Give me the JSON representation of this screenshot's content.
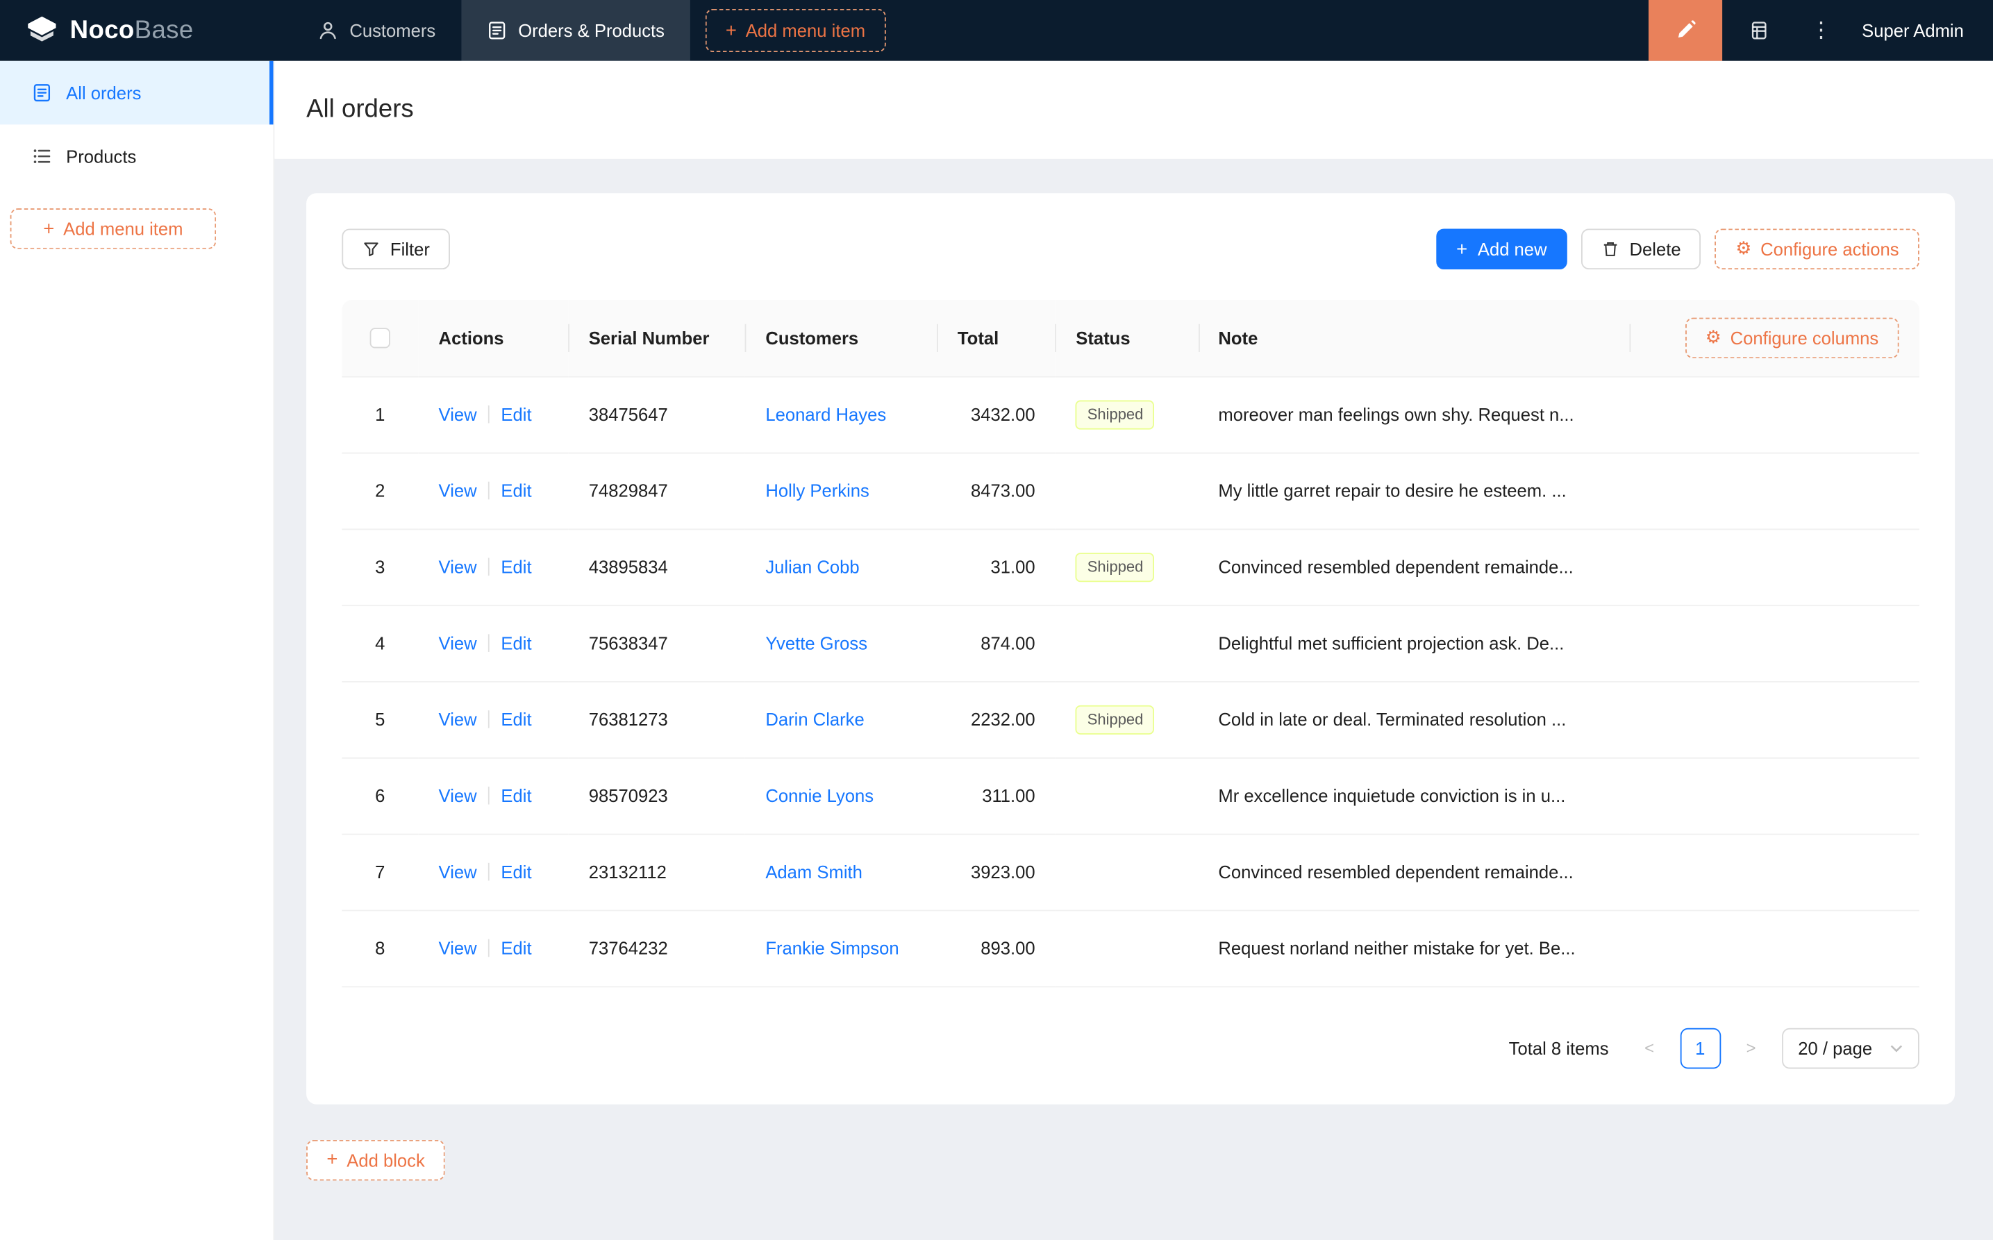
{
  "topbar": {
    "logo_noco": "Noco",
    "logo_base": "Base",
    "tabs": [
      {
        "label": "Customers"
      },
      {
        "label": "Orders & Products"
      }
    ],
    "add_menu_item": "Add menu item",
    "user": "Super Admin"
  },
  "icons": {
    "plus": "+",
    "gear": "⚙",
    "ellipsis": "⋮",
    "prev": "<",
    "next": ">"
  },
  "sidebar": {
    "items": [
      {
        "label": "All orders"
      },
      {
        "label": "Products"
      }
    ],
    "add_menu_item": "Add menu item"
  },
  "page": {
    "title": "All orders"
  },
  "toolbar": {
    "filter": "Filter",
    "add_new": "Add new",
    "delete": "Delete",
    "configure_actions": "Configure actions"
  },
  "table": {
    "columns": {
      "actions": "Actions",
      "serial": "Serial Number",
      "customers": "Customers",
      "total": "Total",
      "status": "Status",
      "note": "Note"
    },
    "configure_columns": "Configure columns",
    "actions": {
      "view": "View",
      "edit": "Edit"
    },
    "rows": [
      {
        "index": 1,
        "serial": "38475647",
        "customer": "Leonard Hayes",
        "total": "3432.00",
        "status": "Shipped",
        "note": "moreover man feelings own shy. Request n..."
      },
      {
        "index": 2,
        "serial": "74829847",
        "customer": "Holly Perkins",
        "total": "8473.00",
        "status": "",
        "note": "My little garret repair to desire he esteem. ..."
      },
      {
        "index": 3,
        "serial": "43895834",
        "customer": "Julian Cobb",
        "total": "31.00",
        "status": "Shipped",
        "note": "Convinced resembled dependent remainde..."
      },
      {
        "index": 4,
        "serial": "75638347",
        "customer": "Yvette Gross",
        "total": "874.00",
        "status": "",
        "note": "Delightful met sufficient projection ask. De..."
      },
      {
        "index": 5,
        "serial": "76381273",
        "customer": "Darin Clarke",
        "total": "2232.00",
        "status": "Shipped",
        "note": "Cold in late or deal. Terminated resolution ..."
      },
      {
        "index": 6,
        "serial": "98570923",
        "customer": "Connie Lyons",
        "total": "311.00",
        "status": "",
        "note": "Mr excellence inquietude conviction is in u..."
      },
      {
        "index": 7,
        "serial": "23132112",
        "customer": "Adam Smith",
        "total": "3923.00",
        "status": "",
        "note": "Convinced resembled dependent remainde..."
      },
      {
        "index": 8,
        "serial": "73764232",
        "customer": "Frankie Simpson",
        "total": "893.00",
        "status": "",
        "note": "Request norland neither mistake for yet. Be..."
      }
    ]
  },
  "pagination": {
    "total": "Total 8 items",
    "page": "1",
    "page_size": "20 / page"
  },
  "add_block": "Add block",
  "colors": {
    "primary": "#1677ff",
    "accent_orange": "#ed7445",
    "designer_button": "#e9815b",
    "topbar_bg": "#0b1c2e",
    "active_item_bg": "#e6f4ff",
    "tag_shipped_bg": "#fcffe6",
    "tag_shipped_border": "#eaff8f",
    "content_bg": "#edeff3"
  }
}
